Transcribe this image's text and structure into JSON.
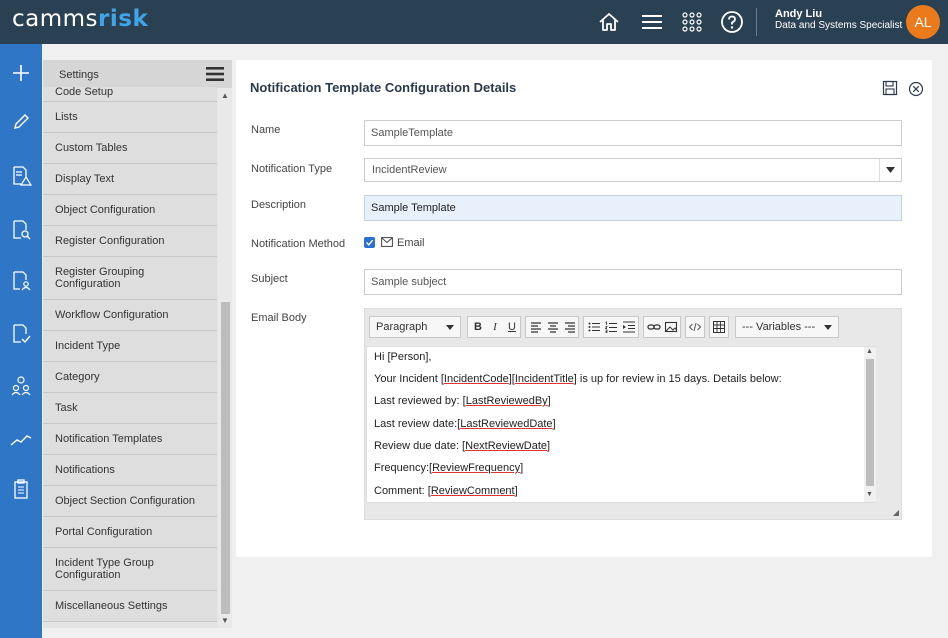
{
  "app": {
    "logo_part1": "camms",
    "logo_part2": "risk"
  },
  "topbar": {
    "icons": [
      "home-icon",
      "menu-icon",
      "apps-grid-icon",
      "help-icon"
    ],
    "user": {
      "name": "Andy Liu",
      "role": "Data and Systems Specialist",
      "initials": "AL"
    }
  },
  "rail": {
    "icons": [
      "plus-icon",
      "pencil-icon",
      "document-warning-icon",
      "document-search-icon",
      "document-person-icon",
      "document-check-icon",
      "people-icon",
      "trend-chart-icon",
      "clipboard-icon"
    ]
  },
  "settings": {
    "title": "Settings",
    "items": [
      "Code Setup",
      "Lists",
      "Custom Tables",
      "Display Text",
      "Object Configuration",
      "Register Configuration",
      "Register Grouping Configuration",
      "Workflow Configuration",
      "Incident Type",
      "Category",
      "Task",
      "Notification Templates",
      "Notifications",
      "Object Section Configuration",
      "Portal Configuration",
      "Incident Type Group Configuration",
      "Miscellaneous Settings"
    ]
  },
  "form": {
    "title": "Notification Template Configuration Details",
    "name_label": "Name",
    "name_value": "SampleTemplate",
    "type_label": "Notification Type",
    "type_value": "IncidentReview",
    "description_label": "Description",
    "description_value": "Sample Template",
    "method_label": "Notification Method",
    "method_option": "Email",
    "method_checked": true,
    "subject_label": "Subject",
    "subject_value": "Sample subject",
    "body_label": "Email Body"
  },
  "editor": {
    "block_format": "Paragraph",
    "variables_placeholder": "--- Variables ---",
    "toolbar_labels": {
      "bold": "B",
      "italic": "I",
      "underline": "U"
    },
    "toolbar_icons": [
      "bold-icon",
      "italic-icon",
      "underline-icon",
      "align-left-icon",
      "align-center-icon",
      "align-right-icon",
      "bullet-list-icon",
      "numbered-list-icon",
      "indent-icon",
      "link-icon",
      "image-icon",
      "code-icon",
      "table-icon"
    ],
    "lines": [
      {
        "pre": "Hi [Person],",
        "link": "",
        "post": ""
      },
      {
        "pre": "Your Incident [",
        "link": "IncidentCode",
        "mid": "][",
        "link2": "IncidentTitle",
        "post": "] is up for review in 15 days. Details below:"
      },
      {
        "pre": "Last reviewed by: [",
        "link": "LastReviewedBy",
        "post": "]"
      },
      {
        "pre": "Last review date:[",
        "link": "LastReviewedDate",
        "post": "]"
      },
      {
        "pre": "Review due date: [",
        "link": "NextReviewDate",
        "post": "]"
      },
      {
        "pre": "Frequency:[",
        "link": "ReviewFrequency",
        "post": "]"
      },
      {
        "pre": "Comment: [",
        "link": "ReviewComment",
        "post": "]"
      }
    ]
  },
  "colors": {
    "topbar": "#2a4154",
    "rail": "#3076c6",
    "logo_accent": "#3fa4e8",
    "avatar": "#ea7a1c",
    "title_text": "#2a3a4c"
  }
}
